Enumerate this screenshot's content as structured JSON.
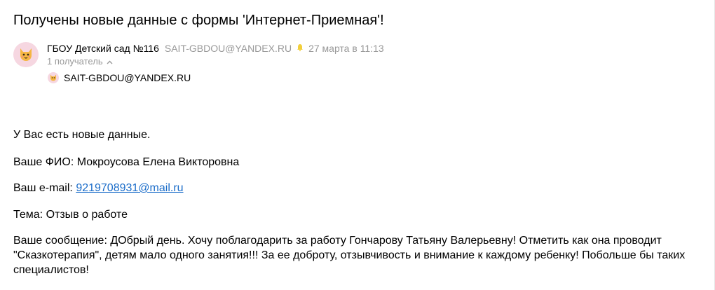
{
  "email": {
    "subject": "Получены новые данные с формы 'Интернет-Приемная'!",
    "sender_name": "ГБОУ Детский сад №116",
    "sender_email": "SAIT-GBDOU@YANDEX.RU",
    "date": "27 марта в 11:13",
    "recipients_toggle": "1 получатель",
    "recipient_email": "SAIT-GBDOU@YANDEX.RU",
    "avatar_icon": "cat-face-icon",
    "bell_icon": "bell-icon",
    "body": {
      "line1": "У Вас есть новые данные.",
      "fio_label": "Ваше ФИО: ",
      "fio_value": "Мокроусова Елена Викторовна",
      "email_label": "Ваш e-mail: ",
      "email_value": "9219708931@mail.ru",
      "topic_label": "Тема: ",
      "topic_value": "Отзыв о работе",
      "message_label": "Ваше сообщение: ",
      "message_value": "ДОбрый день. Хочу поблагодарить за работу Гончарову Татьяну Валерьевну! Отметить как она проводит \"Сказкотерапия\", детям мало одного занятия!!! За ее доброту, отзывчивость и внимание к каждому ребенку! Побольше бы таких специалистов!"
    }
  },
  "colors": {
    "link": "#1a6cc9",
    "muted": "#999999",
    "avatar_bg": "#f6d7e1"
  }
}
